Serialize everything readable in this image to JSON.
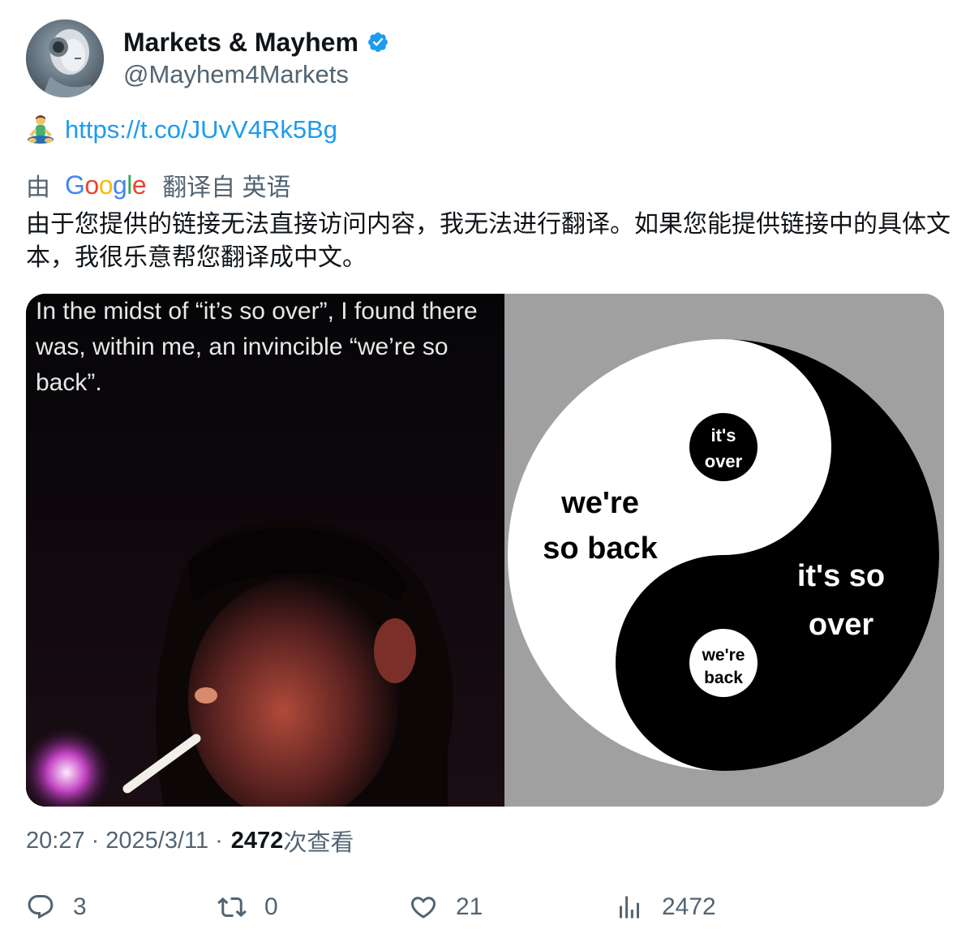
{
  "author": {
    "display_name": "Markets & Mayhem",
    "handle": "@Mayhem4Markets",
    "verified": true
  },
  "post": {
    "emoji_icon": "person-in-lotus-position-emoji",
    "link_text": "https://t.co/JUvV4Rk5Bg",
    "translation_prefix": "由",
    "translation_brand": "Google",
    "translation_suffix": "翻译自 英语",
    "translated_text": "由于您提供的链接无法直接访问内容，我无法进行翻译。如果您能提供链接中的具体文本，我很乐意帮您翻译成中文。"
  },
  "media": {
    "meme_caption": "In the midst of “it’s so over”, I found there was, within me, an invincible “we’re so back”.",
    "yin_yang": {
      "small_dark_line1": "it's",
      "small_dark_line2": "over",
      "white_line1": "we're",
      "white_line2": "so back",
      "black_line1": "it's so",
      "black_line2": "over",
      "small_light_line1": "we're",
      "small_light_line2": "back"
    }
  },
  "meta": {
    "time": "20:27",
    "separator": "·",
    "date": "2025/3/11",
    "views_count": "2472",
    "views_label": "次查看"
  },
  "actions": {
    "replies": "3",
    "reposts": "0",
    "likes": "21",
    "views": "2472"
  },
  "colors": {
    "link": "#1d9bf0",
    "secondary_text": "#536471",
    "primary_text": "#0f1419",
    "verified_badge": "#1d9bf0"
  }
}
